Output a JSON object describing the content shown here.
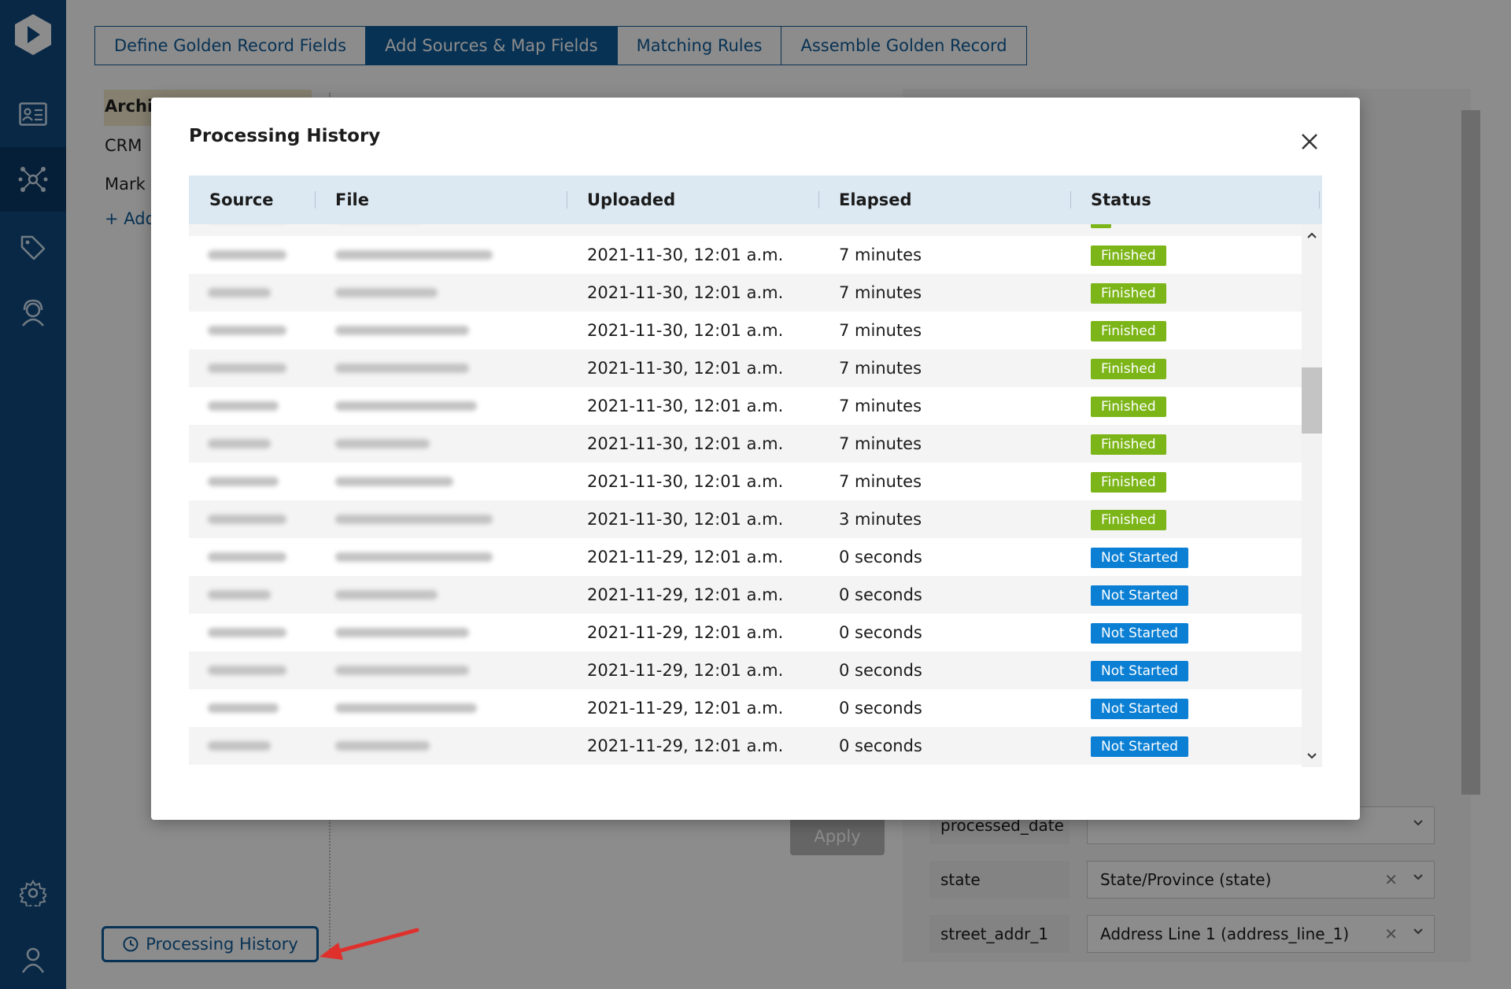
{
  "tabs": [
    {
      "label": "Define Golden Record Fields",
      "active": false
    },
    {
      "label": "Add Sources & Map Fields",
      "active": true
    },
    {
      "label": "Matching Rules",
      "active": false
    },
    {
      "label": "Assemble Golden Record",
      "active": false
    }
  ],
  "sources": {
    "items": [
      "Archi",
      "CRM",
      "Mark"
    ],
    "add_label": "+ Add"
  },
  "apply_label": "Apply",
  "processing_history_button": "Processing History",
  "mappings": [
    {
      "field": "processed_date",
      "value": ""
    },
    {
      "field": "state",
      "value": "State/Province (state)"
    },
    {
      "field": "street_addr_1",
      "value": "Address Line 1 (address_line_1)"
    }
  ],
  "modal": {
    "title": "Processing History",
    "columns": [
      "Source",
      "File",
      "Uploaded",
      "Elapsed",
      "Status"
    ],
    "rows": [
      {
        "uploaded": "2021-11-30, 12:01 a.m.",
        "elapsed": "7 minutes",
        "status": "Finished"
      },
      {
        "uploaded": "2021-11-30, 12:01 a.m.",
        "elapsed": "7 minutes",
        "status": "Finished"
      },
      {
        "uploaded": "2021-11-30, 12:01 a.m.",
        "elapsed": "7 minutes",
        "status": "Finished"
      },
      {
        "uploaded": "2021-11-30, 12:01 a.m.",
        "elapsed": "7 minutes",
        "status": "Finished"
      },
      {
        "uploaded": "2021-11-30, 12:01 a.m.",
        "elapsed": "7 minutes",
        "status": "Finished"
      },
      {
        "uploaded": "2021-11-30, 12:01 a.m.",
        "elapsed": "7 minutes",
        "status": "Finished"
      },
      {
        "uploaded": "2021-11-30, 12:01 a.m.",
        "elapsed": "7 minutes",
        "status": "Finished"
      },
      {
        "uploaded": "2021-11-30, 12:01 a.m.",
        "elapsed": "3 minutes",
        "status": "Finished"
      },
      {
        "uploaded": "2021-11-29, 12:01 a.m.",
        "elapsed": "0 seconds",
        "status": "Not Started"
      },
      {
        "uploaded": "2021-11-29, 12:01 a.m.",
        "elapsed": "0 seconds",
        "status": "Not Started"
      },
      {
        "uploaded": "2021-11-29, 12:01 a.m.",
        "elapsed": "0 seconds",
        "status": "Not Started"
      },
      {
        "uploaded": "2021-11-29, 12:01 a.m.",
        "elapsed": "0 seconds",
        "status": "Not Started"
      },
      {
        "uploaded": "2021-11-29, 12:01 a.m.",
        "elapsed": "0 seconds",
        "status": "Not Started"
      },
      {
        "uploaded": "2021-11-29, 12:01 a.m.",
        "elapsed": "0 seconds",
        "status": "Not Started"
      }
    ]
  },
  "colors": {
    "primary": "#0f5b99",
    "sidebar": "#0f4a80",
    "finished": "#7cb518",
    "not_started": "#0a7fd4",
    "annotation_arrow": "#e0302c"
  },
  "icons": {
    "sidebar": [
      "logo-icon",
      "contact-card-icon",
      "network-icon",
      "tag-icon",
      "support-icon",
      "gear-icon",
      "user-icon"
    ],
    "modal_close": "close-icon",
    "history_button": "history-icon"
  }
}
